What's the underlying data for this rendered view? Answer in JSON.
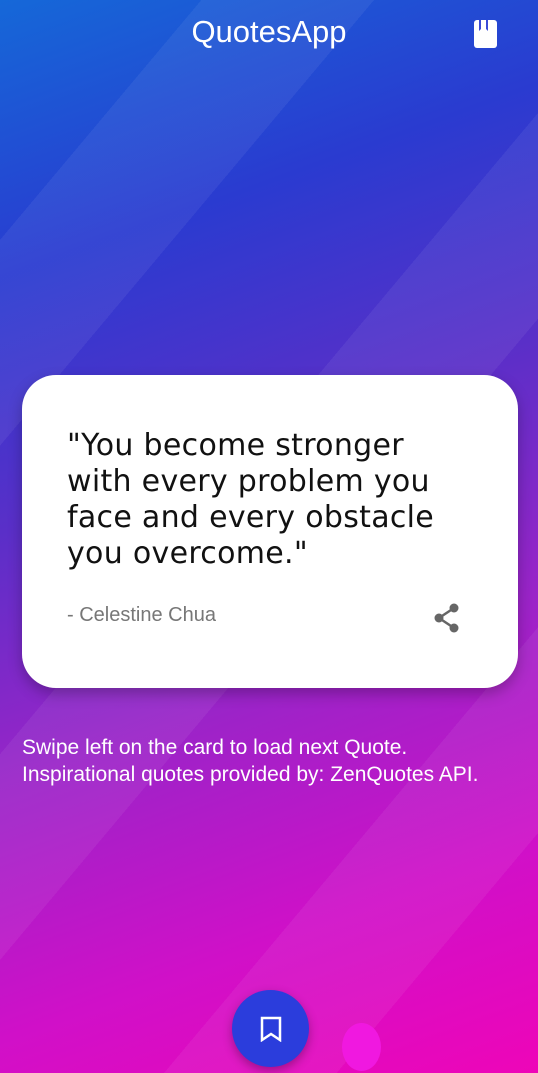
{
  "header": {
    "title": "QuotesApp",
    "saved_icon": "bookmark-book-icon"
  },
  "card": {
    "quote": "\"You become stronger with every problem you face and every obstacle you overcome.\"",
    "author": "- Celestine Chua",
    "share_icon": "share-icon"
  },
  "info": {
    "text": "Swipe left on the card to load next Quote. Inspirational quotes provided by: ZenQuotes API."
  },
  "fab": {
    "icon": "bookmark-icon",
    "color": "#2b3ddc"
  }
}
